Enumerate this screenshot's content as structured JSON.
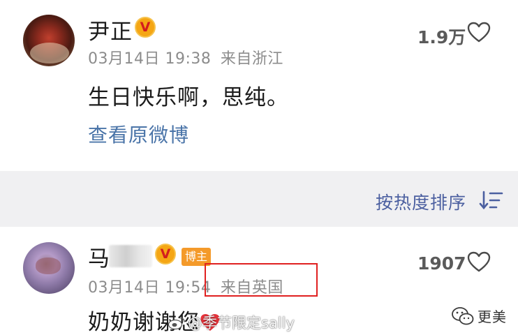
{
  "comments": [
    {
      "author": "尹正",
      "verified_icon": "v-verified-icon",
      "date": "03月14日 19:38",
      "source": "来自",
      "location": "来自浙江",
      "like_count": "1.9万",
      "text": "生日快乐啊，思纯。",
      "view_original_label": "查看原微博"
    },
    {
      "author": "马",
      "verified_icon": "v-verified-icon",
      "role_tag": "博主",
      "date": "03月14日 19:54",
      "source": "来自",
      "location": "来自英国",
      "like_count": "1907",
      "text": "奶奶谢谢您"
    }
  ],
  "sort_bar": {
    "label": "按热度排序",
    "icon": "sort-icon"
  },
  "watermarks": {
    "weibo_handle": "@季节限定sally",
    "wechat_account": "更美"
  },
  "colors": {
    "sort_accent": "#4b5fa0",
    "link": "#4a74a8",
    "verified_badge": "#f5a614",
    "blogger_tag": "#f49a2a",
    "highlight_border": "#e02020",
    "heart_red": "#e8333b"
  }
}
